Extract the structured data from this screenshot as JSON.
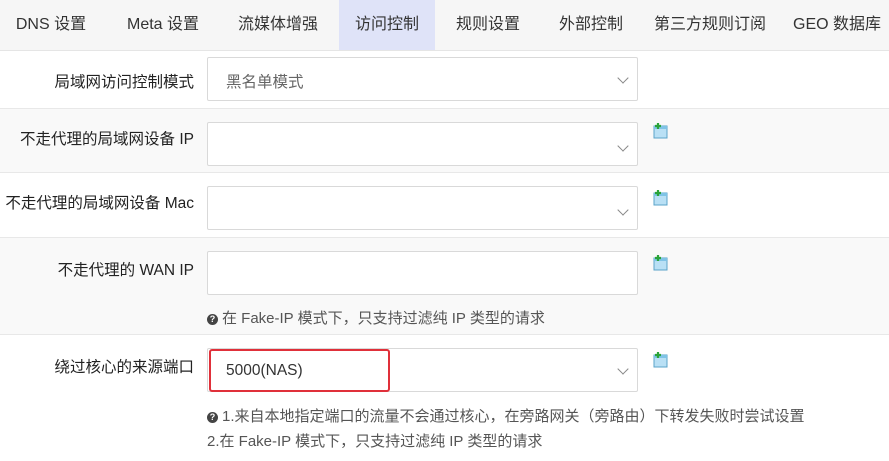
{
  "tabs": [
    {
      "label": "DNS 设置",
      "active": false
    },
    {
      "label": "Meta 设置",
      "active": false
    },
    {
      "label": "流媒体增强",
      "active": false
    },
    {
      "label": "访问控制",
      "active": true
    },
    {
      "label": "规则设置",
      "active": false
    },
    {
      "label": "外部控制",
      "active": false
    },
    {
      "label": "第三方规则订阅",
      "active": false
    },
    {
      "label": "GEO 数据库",
      "active": false
    }
  ],
  "form": {
    "lan_mode": {
      "label": "局域网访问控制模式",
      "value": "黑名单模式"
    },
    "lan_ip": {
      "label": "不走代理的局域网设备 IP",
      "value": ""
    },
    "lan_mac": {
      "label": "不走代理的局域网设备 Mac",
      "value": ""
    },
    "wan_ip": {
      "label": "不走代理的 WAN IP",
      "value": "",
      "hint": "在 Fake-IP 模式下，只支持过滤纯 IP 类型的请求"
    },
    "bypass_port": {
      "label": "绕过核心的来源端口",
      "value": "5000(NAS)",
      "hint_line1": "1.来自本地指定端口的流量不会通过核心，在旁路网关（旁路由）下转发失败时尝试设置",
      "hint_line2": "2.在 Fake-IP 模式下，只支持过滤纯 IP 类型的请求"
    }
  },
  "icons": {
    "add": "add-entry-icon",
    "info": "info-icon",
    "dropdown": "chevron-down-icon"
  },
  "colors": {
    "active_tab_bg": "#dfe3f8",
    "highlight": "#e0303a"
  }
}
